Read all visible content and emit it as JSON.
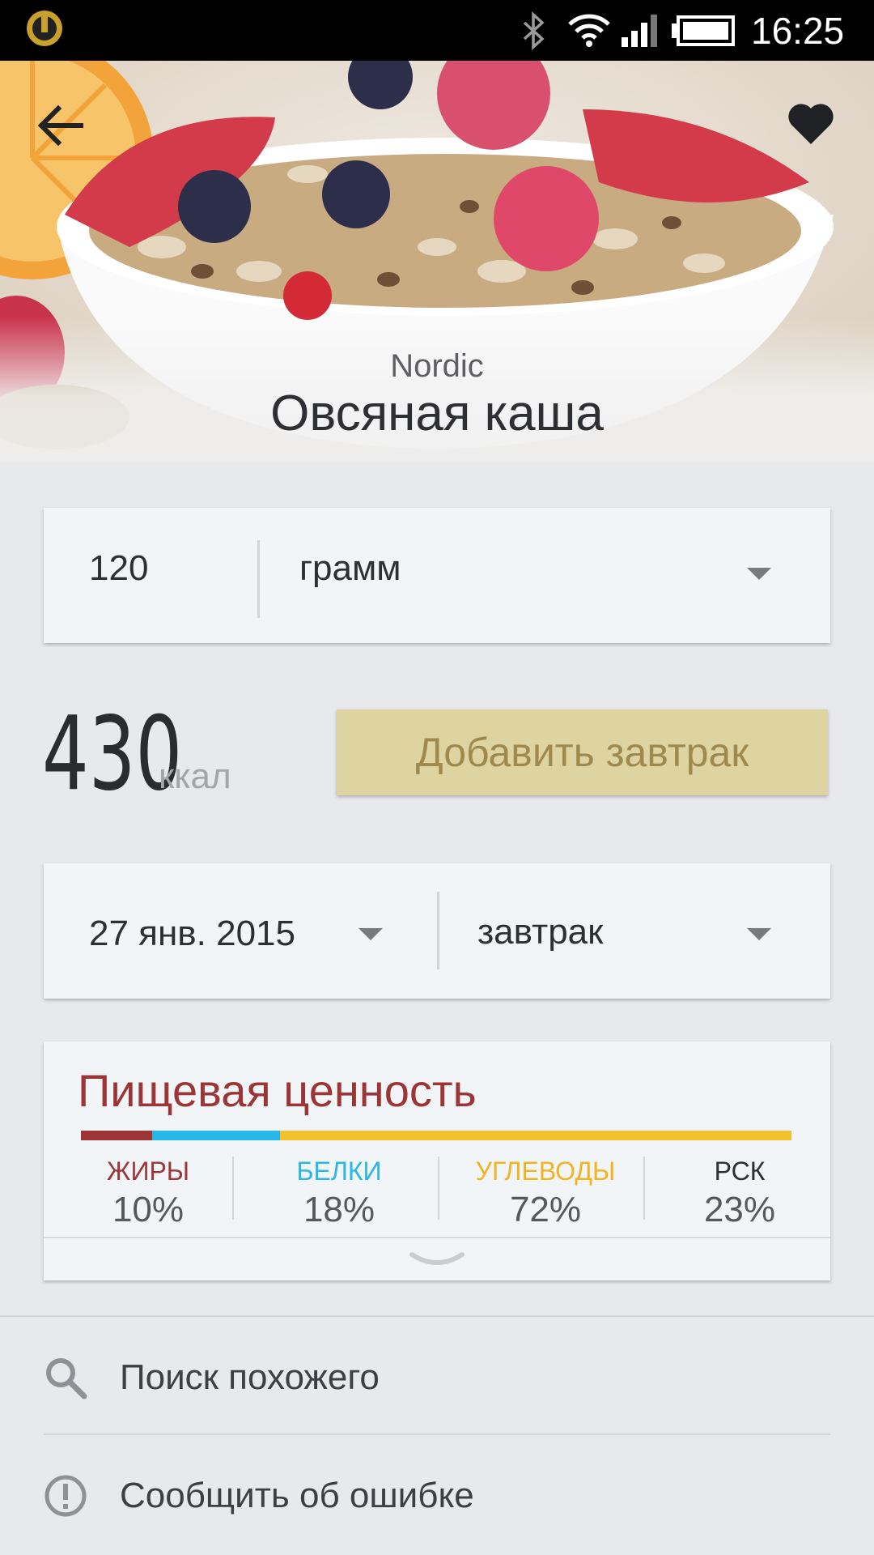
{
  "status_bar": {
    "time": "16:25",
    "icons": [
      "app-logo-icon",
      "bluetooth-icon",
      "wifi-icon",
      "signal-icon",
      "battery-icon"
    ]
  },
  "header": {
    "brand": "Nordic",
    "title": "Овсяная каша",
    "back_icon": "arrow-left-icon",
    "favorite_icon": "heart-icon"
  },
  "portion": {
    "quantity": "120",
    "unit": "грамм"
  },
  "calories": {
    "value": "430",
    "unit": "ккал"
  },
  "add_button": {
    "label": "Добавить завтрак"
  },
  "meal": {
    "date": "27 янв. 2015",
    "type": "завтрак"
  },
  "nutrition": {
    "title": "Пищевая ценность",
    "items": [
      {
        "label": "ЖИРЫ",
        "value": "10%",
        "color": "#9b3536"
      },
      {
        "label": "БЕЛКИ",
        "value": "18%",
        "color": "#29b6e8"
      },
      {
        "label": "УГЛЕВОДЫ",
        "value": "72%",
        "color": "#f2c12e"
      },
      {
        "label": "РСК",
        "value": "23%",
        "color": "#2d2f33"
      }
    ],
    "bar": [
      {
        "name": "fat",
        "fraction": 0.1,
        "color": "#9b3536"
      },
      {
        "name": "protein",
        "fraction": 0.18,
        "color": "#29b6e8"
      },
      {
        "name": "carbs",
        "fraction": 0.72,
        "color": "#f2c12e"
      }
    ]
  },
  "menu": [
    {
      "label": "Поиск похожего",
      "icon": "search-icon"
    },
    {
      "label": "Сообщить об ошибке",
      "icon": "alert-circle-icon"
    }
  ]
}
